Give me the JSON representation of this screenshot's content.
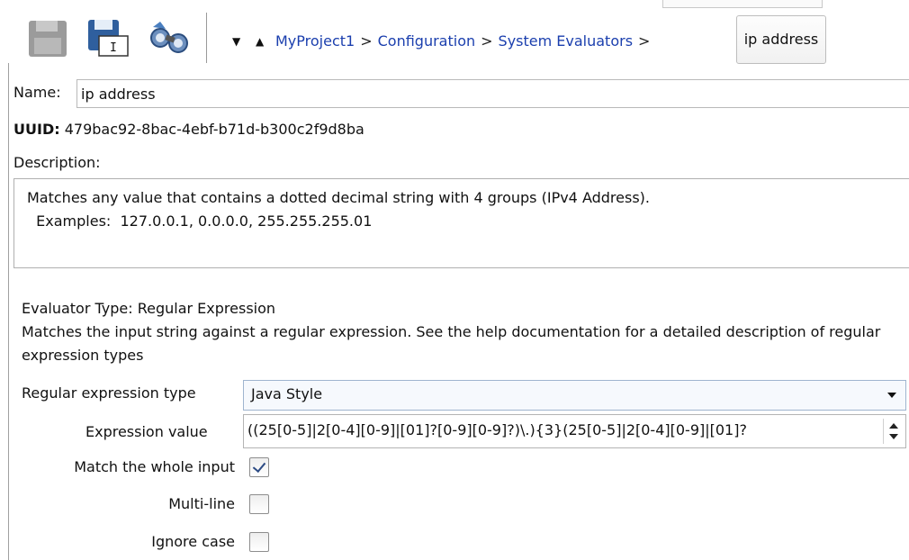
{
  "toolbar": {
    "save_icon": "save-disabled-icon",
    "save_as_icon": "save-as-icon",
    "find_icon": "binoculars-icon",
    "nav_down": "▼",
    "nav_up": "▲"
  },
  "breadcrumb": {
    "items": [
      "MyProject1",
      "Configuration",
      "System Evaluators"
    ],
    "separator": ">",
    "current": "ip address"
  },
  "form": {
    "name_label": "Name:",
    "name_value": "ip address",
    "uuid_label": "UUID:",
    "uuid_value": "479bac92-8bac-4ebf-b71d-b300c2f9d8ba",
    "description_label": "Description:",
    "description_line1": "Matches any value that contains a dotted decimal string with 4 groups (IPv4 Address).",
    "description_line2": "  Examples:  127.0.0.1, 0.0.0.0, 255.255.255.01",
    "evaluator_type": "Evaluator Type:  Regular Expression",
    "evaluator_desc": "Matches the input string against a regular expression.  See the help documentation for a detailed description of regular expression types",
    "regex_type_label": "Regular expression type",
    "regex_type_value": "Java Style",
    "expression_label": "Expression value",
    "expression_value": "((25[0-5]|2[0-4][0-9]|[01]?[0-9][0-9]?)\\.){3}(25[0-5]|2[0-4][0-9]|[01]?",
    "match_whole_label": "Match the whole input",
    "match_whole_checked": true,
    "multiline_label": "Multi-line",
    "multiline_checked": false,
    "ignore_case_label": "Ignore case",
    "ignore_case_checked": false
  },
  "colors": {
    "link": "#1b3fae",
    "checkmark": "#2c4b84"
  }
}
